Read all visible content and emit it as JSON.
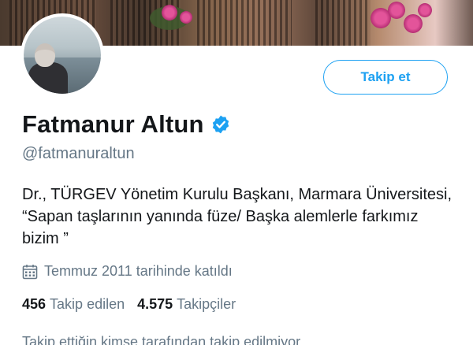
{
  "profile": {
    "display_name": "Fatmanur Altun",
    "handle": "@fatmanuraltun",
    "bio": "Dr., TÜRGEV Yönetim Kurulu Başkanı, Marmara Üniversitesi, “Sapan taşlarının yanında füze/ Başka alemlerle farkımız bizim ”",
    "joined": "Temmuz 2011 tarihinde katıldı",
    "verified": true
  },
  "actions": {
    "follow_label": "Takip et"
  },
  "stats": {
    "following_count": "456",
    "following_label": "Takip edilen",
    "followers_count": "4.575",
    "followers_label": "Takipçiler"
  },
  "followers_note": "Takip ettiğin kimse tarafından takip edilmiyor",
  "colors": {
    "accent": "#1da1f2",
    "secondary_text": "#657786",
    "primary_text": "#14171a"
  },
  "icons": {
    "verified": "verified-badge-icon",
    "calendar": "calendar-icon"
  }
}
